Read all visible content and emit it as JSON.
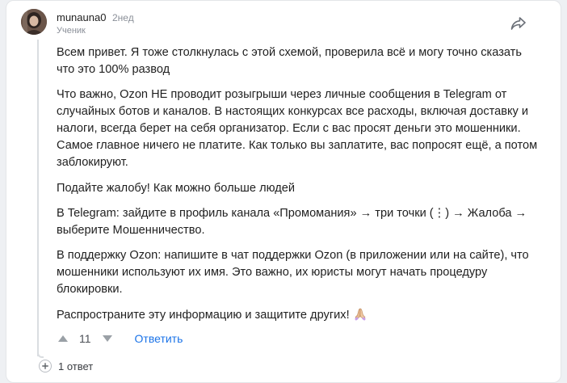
{
  "comment": {
    "author": "munauna0",
    "time": "2нед",
    "role": "Ученик",
    "paragraphs": [
      "Всем привет. Я тоже столкнулась с этой схемой, проверила всё и могу точно сказать что это 100% развод",
      "Что важно, Ozon НЕ проводит розыгрыши через личные сообщения в Telegram от случайных ботов и каналов. В настоящих конкурсах все расходы, включая доставку и налоги, всегда берет на себя организатор. Если с вас просят деньги это мошенники. Самое главное ничего не платите. Как только вы заплатите, вас попросят ещё, а потом заблокируют.",
      "Подайте жалобу! Как можно больше людей",
      "В Telegram: зайдите в профиль канала «Промомания» → три точки (⋮) → Жалоба → выберите Мошенничество.",
      "В поддержку Ozon: напишите в чат поддержки Ozon (в приложении или на сайте), что мошенники используют их имя. Это важно, их юристы могут начать процедуру блокировки.",
      "Распространите эту информацию и защитите других!"
    ],
    "emoji": "folded-hands"
  },
  "actions": {
    "score": "11",
    "reply_label": "Ответить"
  },
  "replies": {
    "label": "1 ответ"
  },
  "icons": {
    "share": "share-icon",
    "upvote": "upvote-icon",
    "downvote": "downvote-icon",
    "expand": "plus-icon"
  },
  "colors": {
    "accent": "#1a73e8",
    "muted": "#8a8f98",
    "vote": "#9aa0a6"
  }
}
